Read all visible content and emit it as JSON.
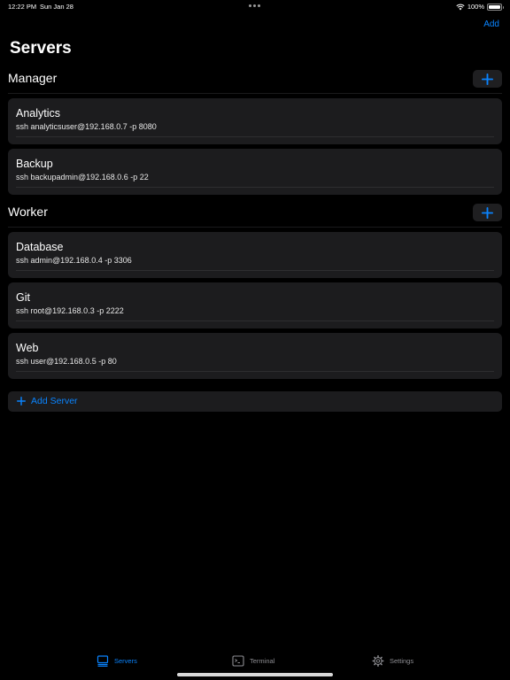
{
  "status_bar": {
    "time": "12:22 PM",
    "date": "Sun Jan 28",
    "battery": "100%"
  },
  "nav": {
    "add_label": "Add",
    "title": "Servers"
  },
  "sections": [
    {
      "title": "Manager",
      "servers": [
        {
          "name": "Analytics",
          "command": "ssh analyticsuser@192.168.0.7 -p 8080"
        },
        {
          "name": "Backup",
          "command": "ssh backupadmin@192.168.0.6 -p 22"
        }
      ]
    },
    {
      "title": "Worker",
      "servers": [
        {
          "name": "Database",
          "command": "ssh admin@192.168.0.4 -p 3306"
        },
        {
          "name": "Git",
          "command": "ssh root@192.168.0.3 -p 2222"
        },
        {
          "name": "Web",
          "command": "ssh user@192.168.0.5 -p 80"
        }
      ]
    }
  ],
  "add_server_label": "Add Server",
  "tab_bar": {
    "tabs": [
      {
        "label": "Servers",
        "icon": "server-icon",
        "active": true
      },
      {
        "label": "Terminal",
        "icon": "terminal-icon",
        "active": false
      },
      {
        "label": "Settings",
        "icon": "gear-icon",
        "active": false
      }
    ]
  },
  "colors": {
    "accent": "#0a84ff",
    "background": "#000000",
    "card": "#1c1c1e",
    "inactive_tab": "#8e8e93"
  }
}
